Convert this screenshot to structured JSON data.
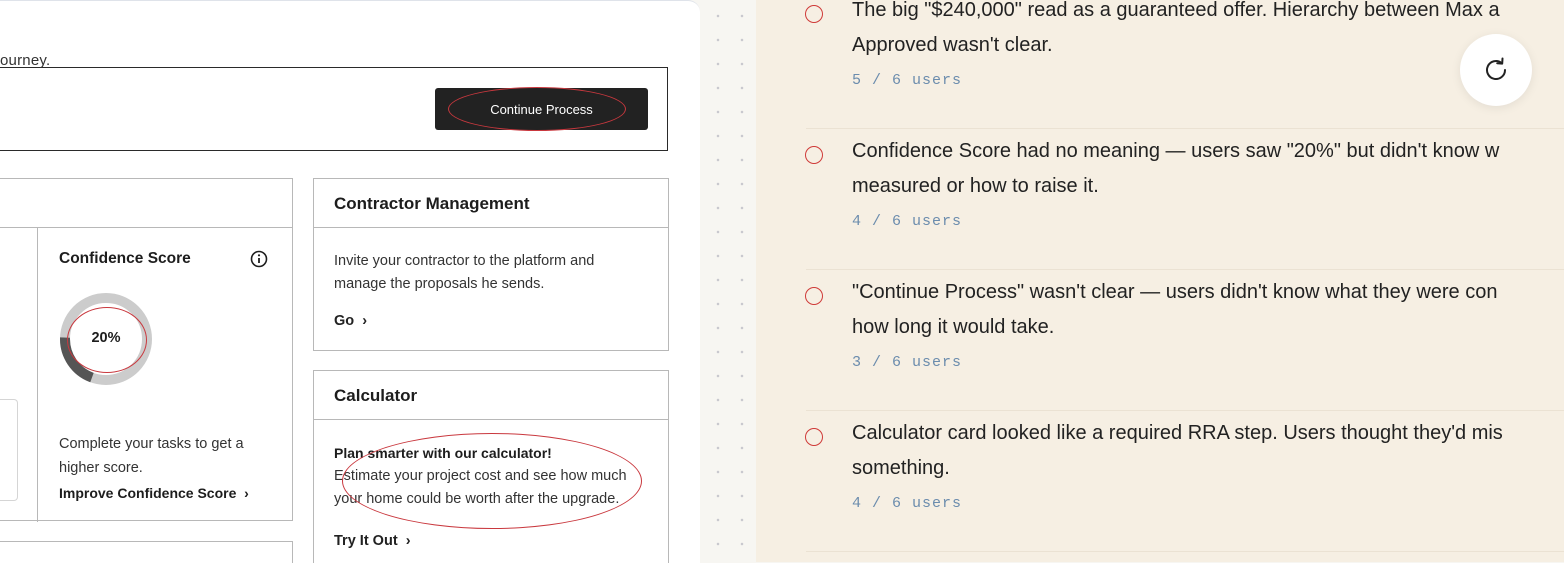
{
  "journey_banner": {
    "text_fragment": "ourney.",
    "continue_label": "Continue Process"
  },
  "confidence_card": {
    "title": "Confidence Score",
    "score_label": "20%",
    "score_fraction": 0.2,
    "description": "Complete your tasks to get a higher score.",
    "link_label": "Improve Confidence Score"
  },
  "contractor_card": {
    "title": "Contractor Management",
    "description": "Invite your contractor to the platform and manage the proposals he sends.",
    "link_label": "Go"
  },
  "calculator_card": {
    "title": "Calculator",
    "headline": "Plan smarter with our calculator!",
    "description": "Estimate your project cost and see how much your home could be worth after the upgrade.",
    "link_label": "Try It Out"
  },
  "issues": [
    {
      "text_line1": "The big \"$240,000\" read as a guaranteed offer. Hierarchy between Max a",
      "text_line2": "Approved wasn't clear.",
      "users": "5 / 6 users"
    },
    {
      "text_line1": "Confidence Score had no meaning — users saw \"20%\" but didn't know w",
      "text_line2": "measured or how to raise it.",
      "users": "4 / 6 users"
    },
    {
      "text_line1": "\"Continue Process\" wasn't clear — users didn't know what they were con",
      "text_line2": "how long it would take.",
      "users": "3 / 6 users"
    },
    {
      "text_line1": "Calculator card looked like a required RRA step. Users thought they'd mis",
      "text_line2": "something.",
      "users": "4 / 6 users"
    }
  ],
  "colors": {
    "annotation_red": "#c9383e",
    "issue_bg": "#f6efe3",
    "users_meta": "#6b8cad",
    "gauge_track": "#cccccc",
    "gauge_fill": "#555555"
  },
  "icons": {
    "info": "info-icon",
    "chevron": "chevron-right-icon",
    "refresh": "refresh-icon"
  }
}
